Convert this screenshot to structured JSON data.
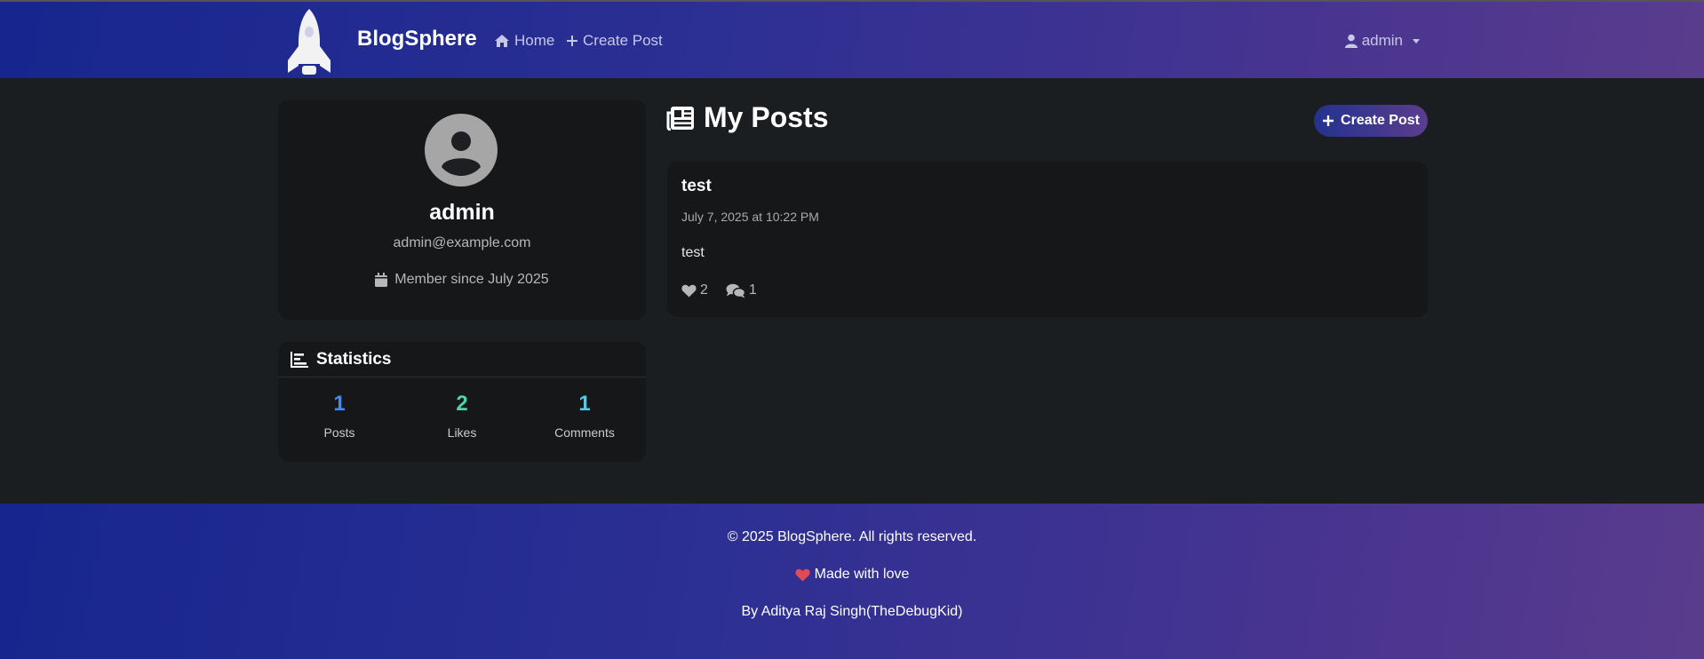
{
  "navbar": {
    "brand": "BlogSphere",
    "home_label": "Home",
    "create_label": "Create Post",
    "user_label": "admin"
  },
  "profile": {
    "name": "admin",
    "email": "admin@example.com",
    "member_since": "Member since July 2025"
  },
  "statistics": {
    "title": "Statistics",
    "items": [
      {
        "value": "1",
        "label": "Posts",
        "color": "#3d8bfd"
      },
      {
        "value": "2",
        "label": "Likes",
        "color": "#49d6a4"
      },
      {
        "value": "1",
        "label": "Comments",
        "color": "#3dd5f3"
      }
    ]
  },
  "posts": {
    "title": "My Posts",
    "create_label": "Create Post",
    "items": [
      {
        "title": "test",
        "date": "July 7, 2025 at 10:22 PM",
        "body": "test",
        "likes": "2",
        "comments": "1"
      }
    ]
  },
  "footer": {
    "copyright": "© 2025 BlogSphere. All rights reserved.",
    "made_with": "Made with love",
    "author": "By Aditya Raj Singh(TheDebugKid)"
  },
  "colors": {
    "accent_gradient_start": "#16268e",
    "accent_gradient_end": "#5a3c8c",
    "heart": "#e04b5a"
  }
}
